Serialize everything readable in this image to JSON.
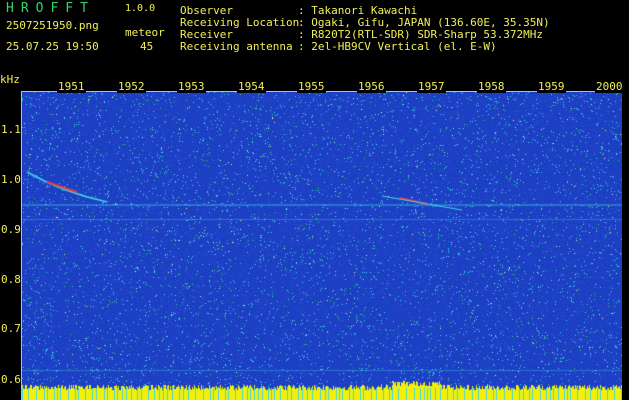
{
  "header": {
    "app_title": "HROFFT",
    "version": "1.0.0",
    "file_name": "2507251950.png",
    "date_time": "25.07.25 19:50",
    "meteor_label": "meteor",
    "meteor_count": "45"
  },
  "info": [
    {
      "key": "Observer",
      "value": ": Takanori Kawachi"
    },
    {
      "key": "Receiving Location",
      "value": ": Ogaki, Gifu, JAPAN (136.60E, 35.35N)"
    },
    {
      "key": "Receiver",
      "value": ": R820T2(RTL-SDR) SDR-Sharp 53.372MHz"
    },
    {
      "key": "Receiving antenna",
      "value": ": 2el-HB9CV Vertical (el. E-W)"
    }
  ],
  "plot": {
    "y_unit": "kHz",
    "y_ticks": [
      "1.1",
      "1.0",
      "0.9",
      "0.8",
      "0.7",
      "0.6"
    ],
    "x_ticks": [
      "1951",
      "1952",
      "1953",
      "1954",
      "1955",
      "1956",
      "1957",
      "1958",
      "1959",
      "2000"
    ],
    "colors": {
      "background": "#1d3fc4",
      "noise_light": "#3fd8e8",
      "noise_green": "#36c97a",
      "trail_red": "#e8394a",
      "floor_yellow": "#f4f000"
    }
  }
}
